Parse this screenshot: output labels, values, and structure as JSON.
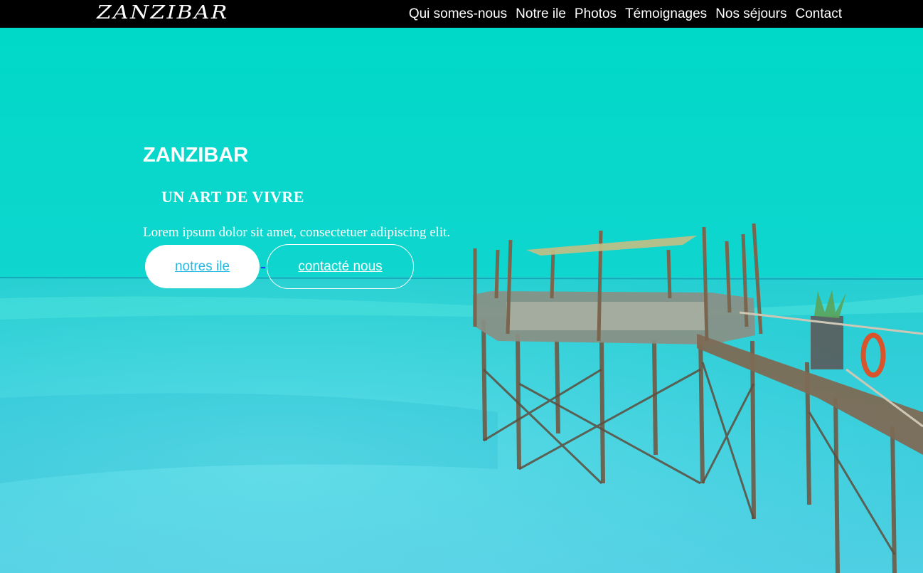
{
  "nav": {
    "logo": "ZANZIBAR",
    "links": [
      "Qui somes-nous",
      "Notre ile",
      "Photos",
      "Témoignages",
      "Nos séjours",
      "Contact"
    ]
  },
  "hero": {
    "title": "ZANZIBAR",
    "subtitle": "UN ART DE VIVRE",
    "text": "Lorem ipsum dolor sit amet, consectetuer adipiscing elit.",
    "primary_button": "notres ile",
    "secondary_button": "contacté nous"
  },
  "colors": {
    "navbar": "#000000",
    "sky": "#00d9c8",
    "sea": "#2fd4e0",
    "button_text": "#29b6e0"
  }
}
